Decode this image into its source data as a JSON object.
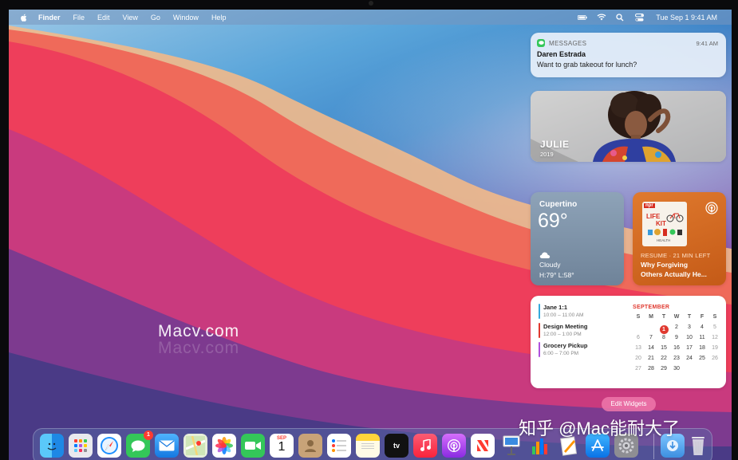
{
  "menubar": {
    "app_name": "Finder",
    "menus": [
      "File",
      "Edit",
      "View",
      "Go",
      "Window",
      "Help"
    ],
    "datetime": "Tue Sep 1  9:41 AM",
    "icons": [
      "apple-icon",
      "battery-icon",
      "wifi-icon",
      "spotlight-icon",
      "control-center-icon"
    ]
  },
  "notification": {
    "app": "MESSAGES",
    "time": "9:41 AM",
    "sender": "Daren Estrada",
    "message": "Want to grab takeout for lunch?"
  },
  "photo_widget": {
    "name": "JULIE",
    "year": "2019"
  },
  "weather": {
    "city": "Cupertino",
    "temperature": "69°",
    "condition": "Cloudy",
    "high_low": "H:79° L:58°"
  },
  "podcast": {
    "art_brand": "npr",
    "art_title_line1": "LIFE",
    "art_title_line2": "KIT",
    "art_subtitle": "HEALTH",
    "status": "RESUME · 21 MIN LEFT",
    "episode_line1": "Why Forgiving",
    "episode_line2": "Others Actually He..."
  },
  "calendar": {
    "month": "SEPTEMBER",
    "events": [
      {
        "title": "Jane 1:1",
        "time": "10:00 – 11:00 AM",
        "color": "#34aadc"
      },
      {
        "title": "Design Meeting",
        "time": "12:00 – 1:00 PM",
        "color": "#e0392f"
      },
      {
        "title": "Grocery Pickup",
        "time": "6:00 – 7:00 PM",
        "color": "#af52de"
      }
    ],
    "weekdays": [
      "S",
      "M",
      "T",
      "W",
      "T",
      "F",
      "S"
    ],
    "weeks": [
      [
        "",
        "",
        "1",
        "2",
        "3",
        "4",
        "5"
      ],
      [
        "6",
        "7",
        "8",
        "9",
        "10",
        "11",
        "12"
      ],
      [
        "13",
        "14",
        "15",
        "16",
        "17",
        "18",
        "19"
      ],
      [
        "20",
        "21",
        "22",
        "23",
        "24",
        "25",
        "26"
      ],
      [
        "27",
        "28",
        "29",
        "30",
        "",
        "",
        ""
      ]
    ],
    "today": "1"
  },
  "edit_widgets_label": "Edit Widgets",
  "watermark": "Macv.com",
  "zhihu_watermark": "知乎 @Mac能耐大了",
  "dock": {
    "messages_badge": "1",
    "calendar_month": "SEP",
    "calendar_day": "1",
    "tv_label": "tv",
    "items": [
      "finder-icon",
      "launchpad-icon",
      "safari-icon",
      "messages-icon",
      "mail-icon",
      "maps-icon",
      "photos-icon",
      "facetime-icon",
      "calendar-icon",
      "contacts-icon",
      "reminders-icon",
      "notes-icon",
      "apple-tv-icon",
      "music-icon",
      "podcasts-icon",
      "news-icon",
      "keynote-icon",
      "numbers-icon",
      "pages-icon",
      "app-store-icon",
      "system-preferences-icon",
      "downloads-icon",
      "trash-icon"
    ]
  }
}
